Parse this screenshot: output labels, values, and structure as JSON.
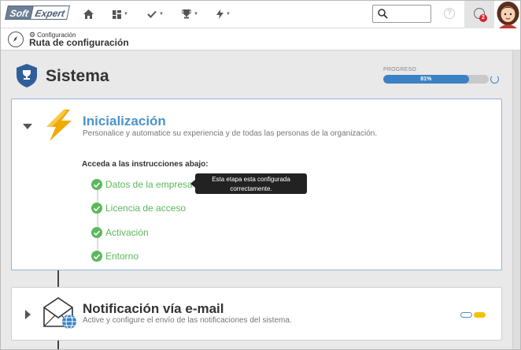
{
  "topbar": {
    "logo_part1": "Soft",
    "logo_part2": "Expert",
    "search_placeholder": "",
    "notification_count": "2",
    "help_symbol": "?"
  },
  "breadcrumb": {
    "parent": "Configuración",
    "title": "Ruta de configuración"
  },
  "section": {
    "title": "Sistema",
    "progress_label": "PROGRESO",
    "progress_text": "81%",
    "progress_value": 0.81
  },
  "card1": {
    "title": "Inicialización",
    "description": "Personalice y automatice su experiencia y de todas las personas de la organización.",
    "instructions": "Acceda a las instrucciones abajo:",
    "steps": [
      {
        "label": "Datos de la empresa"
      },
      {
        "label": "Licencia de acceso"
      },
      {
        "label": "Activación"
      },
      {
        "label": "Entorno"
      }
    ],
    "tooltip_line1": "Esta etapa esta configurada",
    "tooltip_line2": "correctamente."
  },
  "card2": {
    "title": "Notificación vía e-mail",
    "description": "Active y configure el envío de las notificaciones del sistema."
  },
  "colors": {
    "accent_blue": "#4b93c9",
    "progress_blue": "#3b82c4",
    "success_green": "#5cb85c",
    "bolt_orange": "#f2a900",
    "badge_red": "#d9232d"
  }
}
